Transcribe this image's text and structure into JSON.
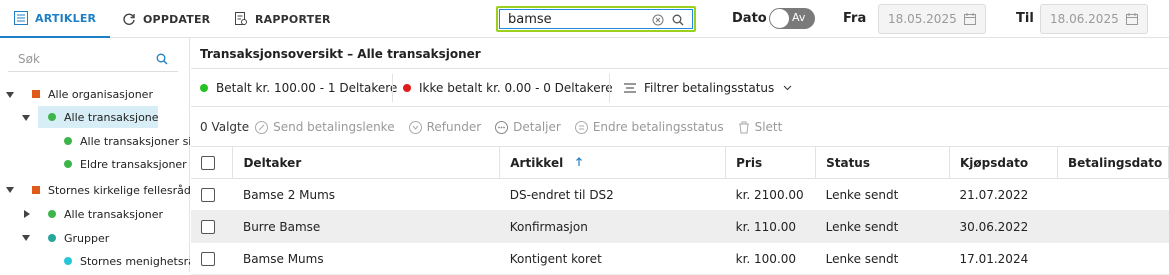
{
  "topbar": {
    "tabs": [
      {
        "label": "ARTIKLER",
        "icon": "list-icon",
        "active": true
      },
      {
        "label": "OPPDATER",
        "icon": "refresh-icon",
        "active": false
      },
      {
        "label": "RAPPORTER",
        "icon": "report-icon",
        "active": false
      }
    ],
    "search_value": "bamse",
    "date_label": "Dato",
    "date_toggle": "Av",
    "from_label": "Fra",
    "from_value": "18.05.2025",
    "to_label": "Til",
    "to_value": "18.06.2025"
  },
  "sidebar": {
    "search_placeholder": "Søk",
    "tree": [
      {
        "label": "Alle organisasjoner",
        "marker": "square",
        "color": "#e05a1c",
        "caret": "down"
      },
      {
        "label": "Alle transaksjoner",
        "marker": "dot",
        "color": "#3cb54a",
        "caret": "down",
        "selected": true
      },
      {
        "label": "Alle transaksjoner siste",
        "marker": "dot",
        "color": "#3cb54a",
        "caret": ""
      },
      {
        "label": "Eldre transaksjoner",
        "marker": "dot",
        "color": "#3cb54a",
        "caret": ""
      },
      {
        "label": "Stornes kirkelige fellesråd",
        "marker": "square",
        "color": "#e05a1c",
        "caret": "down"
      },
      {
        "label": "Alle transaksjoner",
        "marker": "dot",
        "color": "#3cb54a",
        "caret": "right"
      },
      {
        "label": "Grupper",
        "marker": "dot",
        "color": "#26a69a",
        "caret": "down"
      },
      {
        "label": "Stornes menighetsråd",
        "marker": "dot",
        "color": "#26c6da",
        "caret": ""
      }
    ]
  },
  "main": {
    "breadcrumb": "Transaksjonsoversikt – Alle transaksjoner",
    "paid_label": "Betalt kr. 100.00 - 1 Deltakere",
    "paid_color": "#22c322",
    "unpaid_label": "Ikke betalt kr. 0.00 - 0 Deltakere",
    "unpaid_color": "#e01b1b",
    "filter_label": "Filtrer betalingsstatus",
    "selected_count": "0 Valgte",
    "actions": [
      "Send betalingslenke",
      "Refunder",
      "Detaljer",
      "Endre betalingsstatus",
      "Slett"
    ],
    "columns": [
      "Deltaker",
      "Artikkel",
      "Pris",
      "Status",
      "Kjøpsdato",
      "Betalingsdato"
    ],
    "rows": [
      [
        "Bamse 2 Mums",
        "DS-endret til DS2",
        "kr. 2100.00",
        "Lenke sendt",
        "21.07.2022",
        ""
      ],
      [
        "Burre Bamse",
        "Konfirmasjon",
        "kr. 110.00",
        "Lenke sendt",
        "30.06.2022",
        ""
      ],
      [
        "Bamse Mums",
        "Kontigent koret",
        "kr. 100.00",
        "Lenke sendt",
        "17.01.2024",
        ""
      ]
    ]
  }
}
